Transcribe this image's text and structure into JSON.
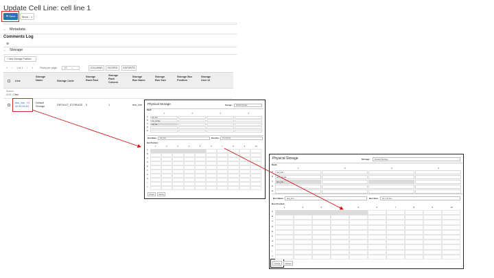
{
  "page": {
    "title": "Update Cell Line: cell line 1",
    "save_label": "Save",
    "save_icon": "save-icon",
    "more_label": "More...",
    "sections": {
      "metadata": "Metadata",
      "comments": "Comments Log",
      "storage": "Storage"
    },
    "new_position_label": "New Storage Position",
    "pager": {
      "first": "«",
      "prev": "‹",
      "page_text": "1 of 1",
      "next": "›",
      "last": "»",
      "rows_label": "Rows per page:",
      "rows_value": "10"
    },
    "table_buttons": [
      "COLUMNS",
      "FILTERS",
      "EXPORTS"
    ],
    "columns": [
      "Line",
      "Storage Name",
      "Storage Code",
      "Storage Rack Row",
      "Storage Rack Column",
      "Storage Box Name",
      "Storage Box Size",
      "Storage Box Position",
      "Storage User Id"
    ],
    "search_label": "Search",
    "search_op": "AND",
    "search_filter": "Clear",
    "row": {
      "line": "test_line : 01 42 83 64 A3",
      "storage_name": "Default Storage",
      "storage_code": "DEFAULT_STORAGE",
      "rack_row": "0",
      "rack_column": "1",
      "box_name": "test_line"
    }
  },
  "dialog_small": {
    "title": "Physical Storage",
    "storage_label": "Storage:",
    "storage_value": "Default Storage",
    "rack_label": "Rack:",
    "rack_cols": [
      "1",
      "2",
      "3",
      "4"
    ],
    "rack_rows": [
      "A",
      "B",
      "C",
      "D",
      "E"
    ],
    "rack_items": [
      "test_line",
      "test_sample",
      "test_line"
    ],
    "box_name_label": "Box Name:",
    "box_name_value": "test_line",
    "box_size_label": "Box Size:",
    "box_size_value": "10 x 10 box",
    "box_pos_label": "Box Position:",
    "box_cols": [
      "1",
      "2",
      "3",
      "4",
      "5",
      "6",
      "7",
      "8",
      "9",
      "10"
    ],
    "box_rows": [
      "A",
      "B",
      "C",
      "D",
      "E",
      "F",
      "G",
      "H",
      "I",
      "J"
    ],
    "accept_label": "Accept",
    "cancel_label": "Cancel"
  },
  "dialog_large": {
    "title": "Physical Storage",
    "storage_label": "Storage:",
    "storage_value": "Default Storage",
    "rack_label": "Rack:",
    "rack_cols": [
      "1",
      "2",
      "3",
      "4"
    ],
    "rack_rows": [
      "A",
      "B",
      "C",
      "D",
      "E"
    ],
    "rack_items": [
      "test_line",
      "test_sample",
      "test_line"
    ],
    "box_name_label": "Box Name:",
    "box_name_value": "test_line",
    "box_size_label": "Box Size:",
    "box_size_value": "10 x 10 box",
    "box_pos_label": "Box Position:",
    "box_cols": [
      "1",
      "2",
      "3",
      "4",
      "5",
      "6",
      "7",
      "8",
      "9",
      "10"
    ],
    "box_rows": [
      "A",
      "B",
      "C",
      "D",
      "E",
      "F",
      "G",
      "H",
      "I",
      "J"
    ],
    "accept_label": "Accept",
    "cancel_label": "Cancel"
  },
  "colors": {
    "accent": "#2a6fb8",
    "highlight": "#dd2222",
    "arrow": "#cc1111"
  }
}
